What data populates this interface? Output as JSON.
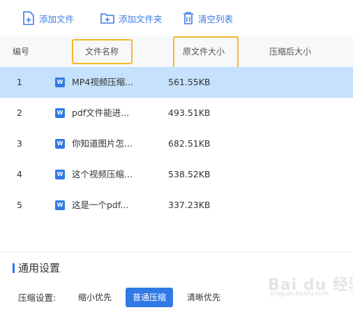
{
  "toolbar": {
    "add_file": "添加文件",
    "add_folder": "添加文件夹",
    "clear_list": "清空列表"
  },
  "table": {
    "headers": {
      "index": "编号",
      "name": "文件名称",
      "original_size": "原文件大小",
      "compressed_size": "压缩后大小"
    },
    "rows": [
      {
        "index": "1",
        "icon": "word-doc-icon",
        "name": "MP4视频压缩...",
        "original_size": "561.55KB",
        "compressed_size": ""
      },
      {
        "index": "2",
        "icon": "word-doc-icon",
        "name": "pdf文件能进...",
        "original_size": "493.51KB",
        "compressed_size": ""
      },
      {
        "index": "3",
        "icon": "word-doc-icon",
        "name": "你知道图片怎...",
        "original_size": "682.51KB",
        "compressed_size": ""
      },
      {
        "index": "4",
        "icon": "word-doc-icon",
        "name": "这个视频压缩...",
        "original_size": "538.52KB",
        "compressed_size": ""
      },
      {
        "index": "5",
        "icon": "word-doc-icon",
        "name": "这是一个pdf...",
        "original_size": "337.23KB",
        "compressed_size": ""
      }
    ],
    "selected_row": "1",
    "doc_icon_glyph": "W"
  },
  "settings": {
    "title": "通用设置",
    "compress_label": "压缩设置:",
    "options": [
      "缩小优先",
      "普通压缩",
      "清晰优先"
    ],
    "selected_option": "普通压缩"
  },
  "watermark": {
    "text": "Bai du 经验",
    "sub": "jingyan.baidu.com"
  },
  "colors": {
    "accent": "#2f7ae5",
    "selected_row_bg": "#c5e1fb",
    "highlight_box": "#f5b829",
    "header_bg": "#f7f8fa"
  }
}
